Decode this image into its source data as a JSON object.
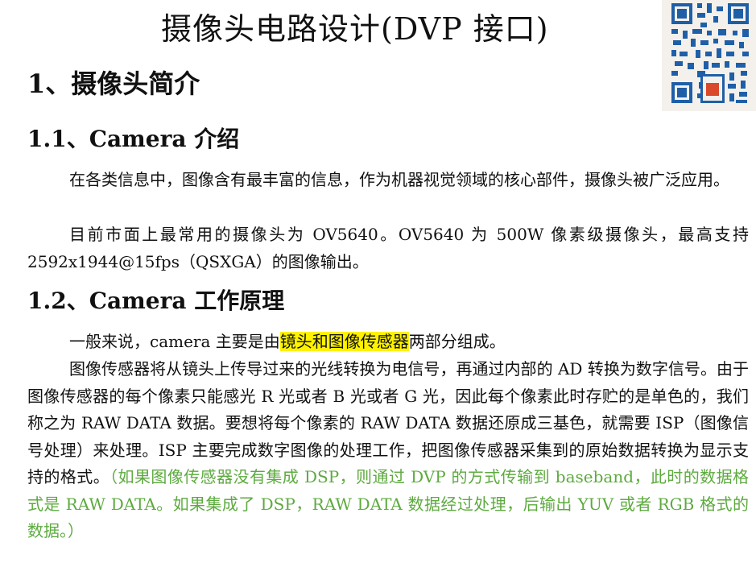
{
  "document": {
    "title": "摄像头电路设计(DVP 接口)",
    "section1": "1、摄像头简介",
    "section1_1": "1.1、Camera 介绍",
    "para1": "在各类信息中，图像含有最丰富的信息，作为机器视觉领域的核心部件，摄像头被广泛应用。",
    "para2": "目前市面上最常用的摄像头为 OV5640。OV5640 为 500W 像素级摄像头，最高支持 2592x1944@15fps（QSXGA）的图像输出。",
    "section1_2": "1.2、Camera 工作原理",
    "para3": {
      "before": "一般来说，camera 主要是由",
      "highlight": "镜头和图像传感器",
      "after": "两部分组成。"
    },
    "para4": {
      "text": "图像传感器将从镜头上传导过来的光线转换为电信号，再通过内部的 AD 转换为数字信号。由于图像传感器的每个像素只能感光 R 光或者 B 光或者 G 光，因此每个像素此时存贮的是单色的，我们称之为 RAW DATA 数据。要想将每个像素的 RAW DATA 数据还原成三基色，就需要 ISP（图像信号处理）来处理。ISP 主要完成数字图像的处理工作，把图像传感器采集到的原始数据转换为显示支持的格式。",
      "note": "（如果图像传感器没有集成 DSP，则通过 DVP 的方式传输到 baseband，此时的数据格式是 RAW DATA。如果集成了 DSP，RAW DATA 数据经过处理，后输出 YUV 或者 RGB 格式的数据。）"
    }
  },
  "colors": {
    "highlight": "#fff200",
    "note_text": "#5daa3f",
    "qr_dark": "#1f5fa8",
    "qr_seal": "#d94a2b"
  },
  "icons": {
    "qr_code": "qr-code-icon"
  }
}
